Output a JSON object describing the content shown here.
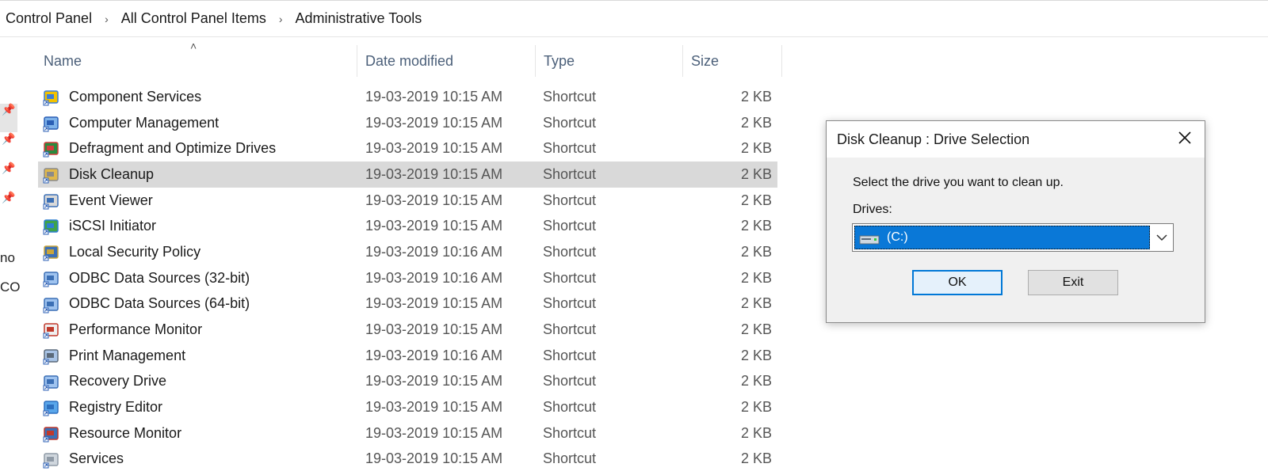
{
  "breadcrumb": [
    "Control Panel",
    "All Control Panel Items",
    "Administrative Tools"
  ],
  "nav_fragments": [
    "no",
    "CO"
  ],
  "columns": {
    "name": "Name",
    "date": "Date modified",
    "type": "Type",
    "size": "Size"
  },
  "files": [
    {
      "name": "Component Services",
      "date": "19-03-2019 10:15 AM",
      "type": "Shortcut",
      "size": "2 KB",
      "icon": "component-services-icon"
    },
    {
      "name": "Computer Management",
      "date": "19-03-2019 10:15 AM",
      "type": "Shortcut",
      "size": "2 KB",
      "icon": "computer-management-icon"
    },
    {
      "name": "Defragment and Optimize Drives",
      "date": "19-03-2019 10:15 AM",
      "type": "Shortcut",
      "size": "2 KB",
      "icon": "defragment-icon"
    },
    {
      "name": "Disk Cleanup",
      "date": "19-03-2019 10:15 AM",
      "type": "Shortcut",
      "size": "2 KB",
      "icon": "disk-cleanup-icon",
      "selected": true
    },
    {
      "name": "Event Viewer",
      "date": "19-03-2019 10:15 AM",
      "type": "Shortcut",
      "size": "2 KB",
      "icon": "event-viewer-icon"
    },
    {
      "name": "iSCSI Initiator",
      "date": "19-03-2019 10:15 AM",
      "type": "Shortcut",
      "size": "2 KB",
      "icon": "iscsi-initiator-icon"
    },
    {
      "name": "Local Security Policy",
      "date": "19-03-2019 10:16 AM",
      "type": "Shortcut",
      "size": "2 KB",
      "icon": "local-security-policy-icon"
    },
    {
      "name": "ODBC Data Sources (32-bit)",
      "date": "19-03-2019 10:16 AM",
      "type": "Shortcut",
      "size": "2 KB",
      "icon": "odbc-icon"
    },
    {
      "name": "ODBC Data Sources (64-bit)",
      "date": "19-03-2019 10:15 AM",
      "type": "Shortcut",
      "size": "2 KB",
      "icon": "odbc-icon"
    },
    {
      "name": "Performance Monitor",
      "date": "19-03-2019 10:15 AM",
      "type": "Shortcut",
      "size": "2 KB",
      "icon": "performance-monitor-icon"
    },
    {
      "name": "Print Management",
      "date": "19-03-2019 10:16 AM",
      "type": "Shortcut",
      "size": "2 KB",
      "icon": "print-management-icon"
    },
    {
      "name": "Recovery Drive",
      "date": "19-03-2019 10:15 AM",
      "type": "Shortcut",
      "size": "2 KB",
      "icon": "recovery-drive-icon"
    },
    {
      "name": "Registry Editor",
      "date": "19-03-2019 10:15 AM",
      "type": "Shortcut",
      "size": "2 KB",
      "icon": "registry-editor-icon"
    },
    {
      "name": "Resource Monitor",
      "date": "19-03-2019 10:15 AM",
      "type": "Shortcut",
      "size": "2 KB",
      "icon": "resource-monitor-icon"
    },
    {
      "name": "Services",
      "date": "19-03-2019 10:15 AM",
      "type": "Shortcut",
      "size": "2 KB",
      "icon": "services-icon"
    }
  ],
  "dialog": {
    "title": "Disk Cleanup : Drive Selection",
    "prompt": "Select the drive you want to clean up.",
    "drives_label": "Drives:",
    "selected_drive": "(C:)",
    "ok": "OK",
    "exit": "Exit"
  },
  "colors": {
    "selected_row": "#d9d9d9",
    "header_text": "#4c607a",
    "combo_highlight": "#0a78d7",
    "default_button_border": "#0078d7"
  }
}
